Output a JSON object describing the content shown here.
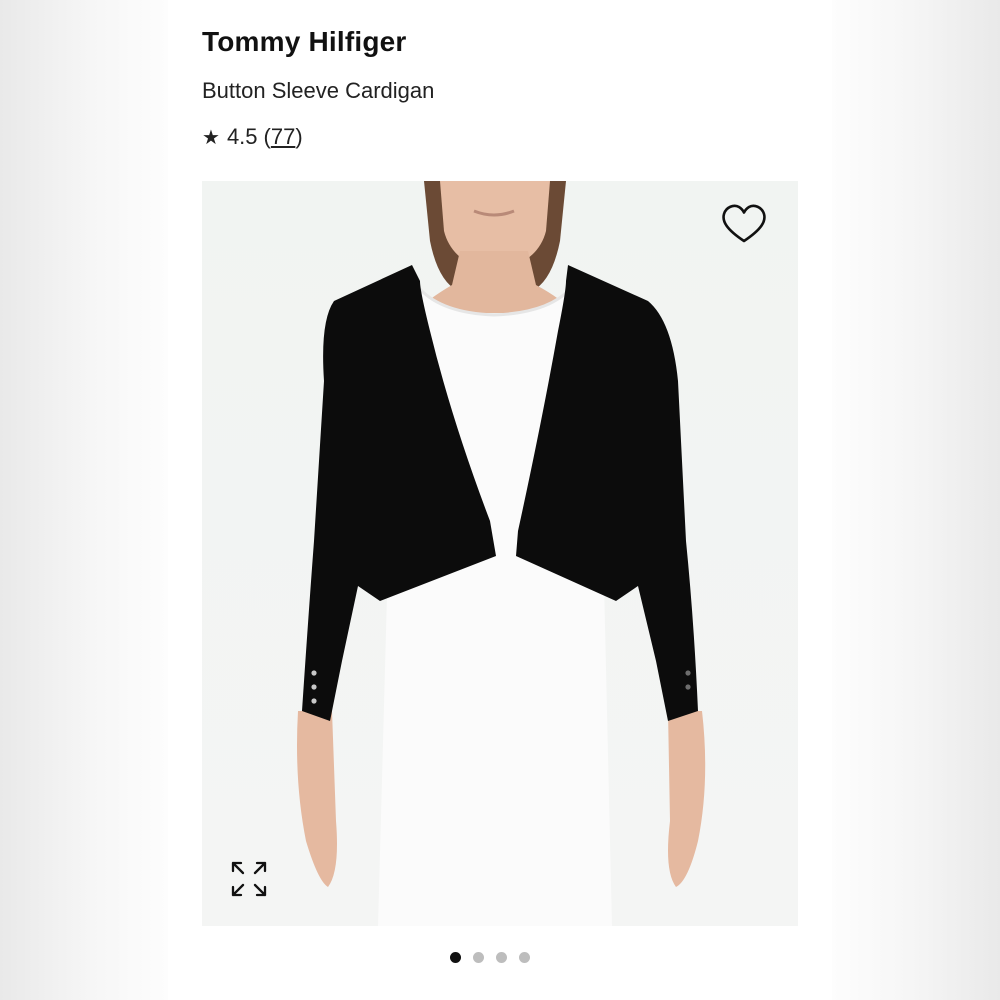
{
  "product": {
    "brand": "Tommy Hilfiger",
    "name": "Button Sleeve Cardigan",
    "rating": {
      "star": "★",
      "value": "4.5",
      "open_paren": "(",
      "count": "77",
      "close_paren": ")"
    }
  },
  "gallery": {
    "image_alt": "Model wearing black button sleeve cardigan over white dress",
    "wishlist_icon": "heart-outline-icon",
    "expand_icon": "expand-arrows-icon",
    "slide_count": 4,
    "active_slide": 1
  },
  "colors": {
    "text": "#111111",
    "cardigan": "#0c0c0c",
    "dot_active": "#111111",
    "dot_inactive": "#bdbdbd"
  }
}
